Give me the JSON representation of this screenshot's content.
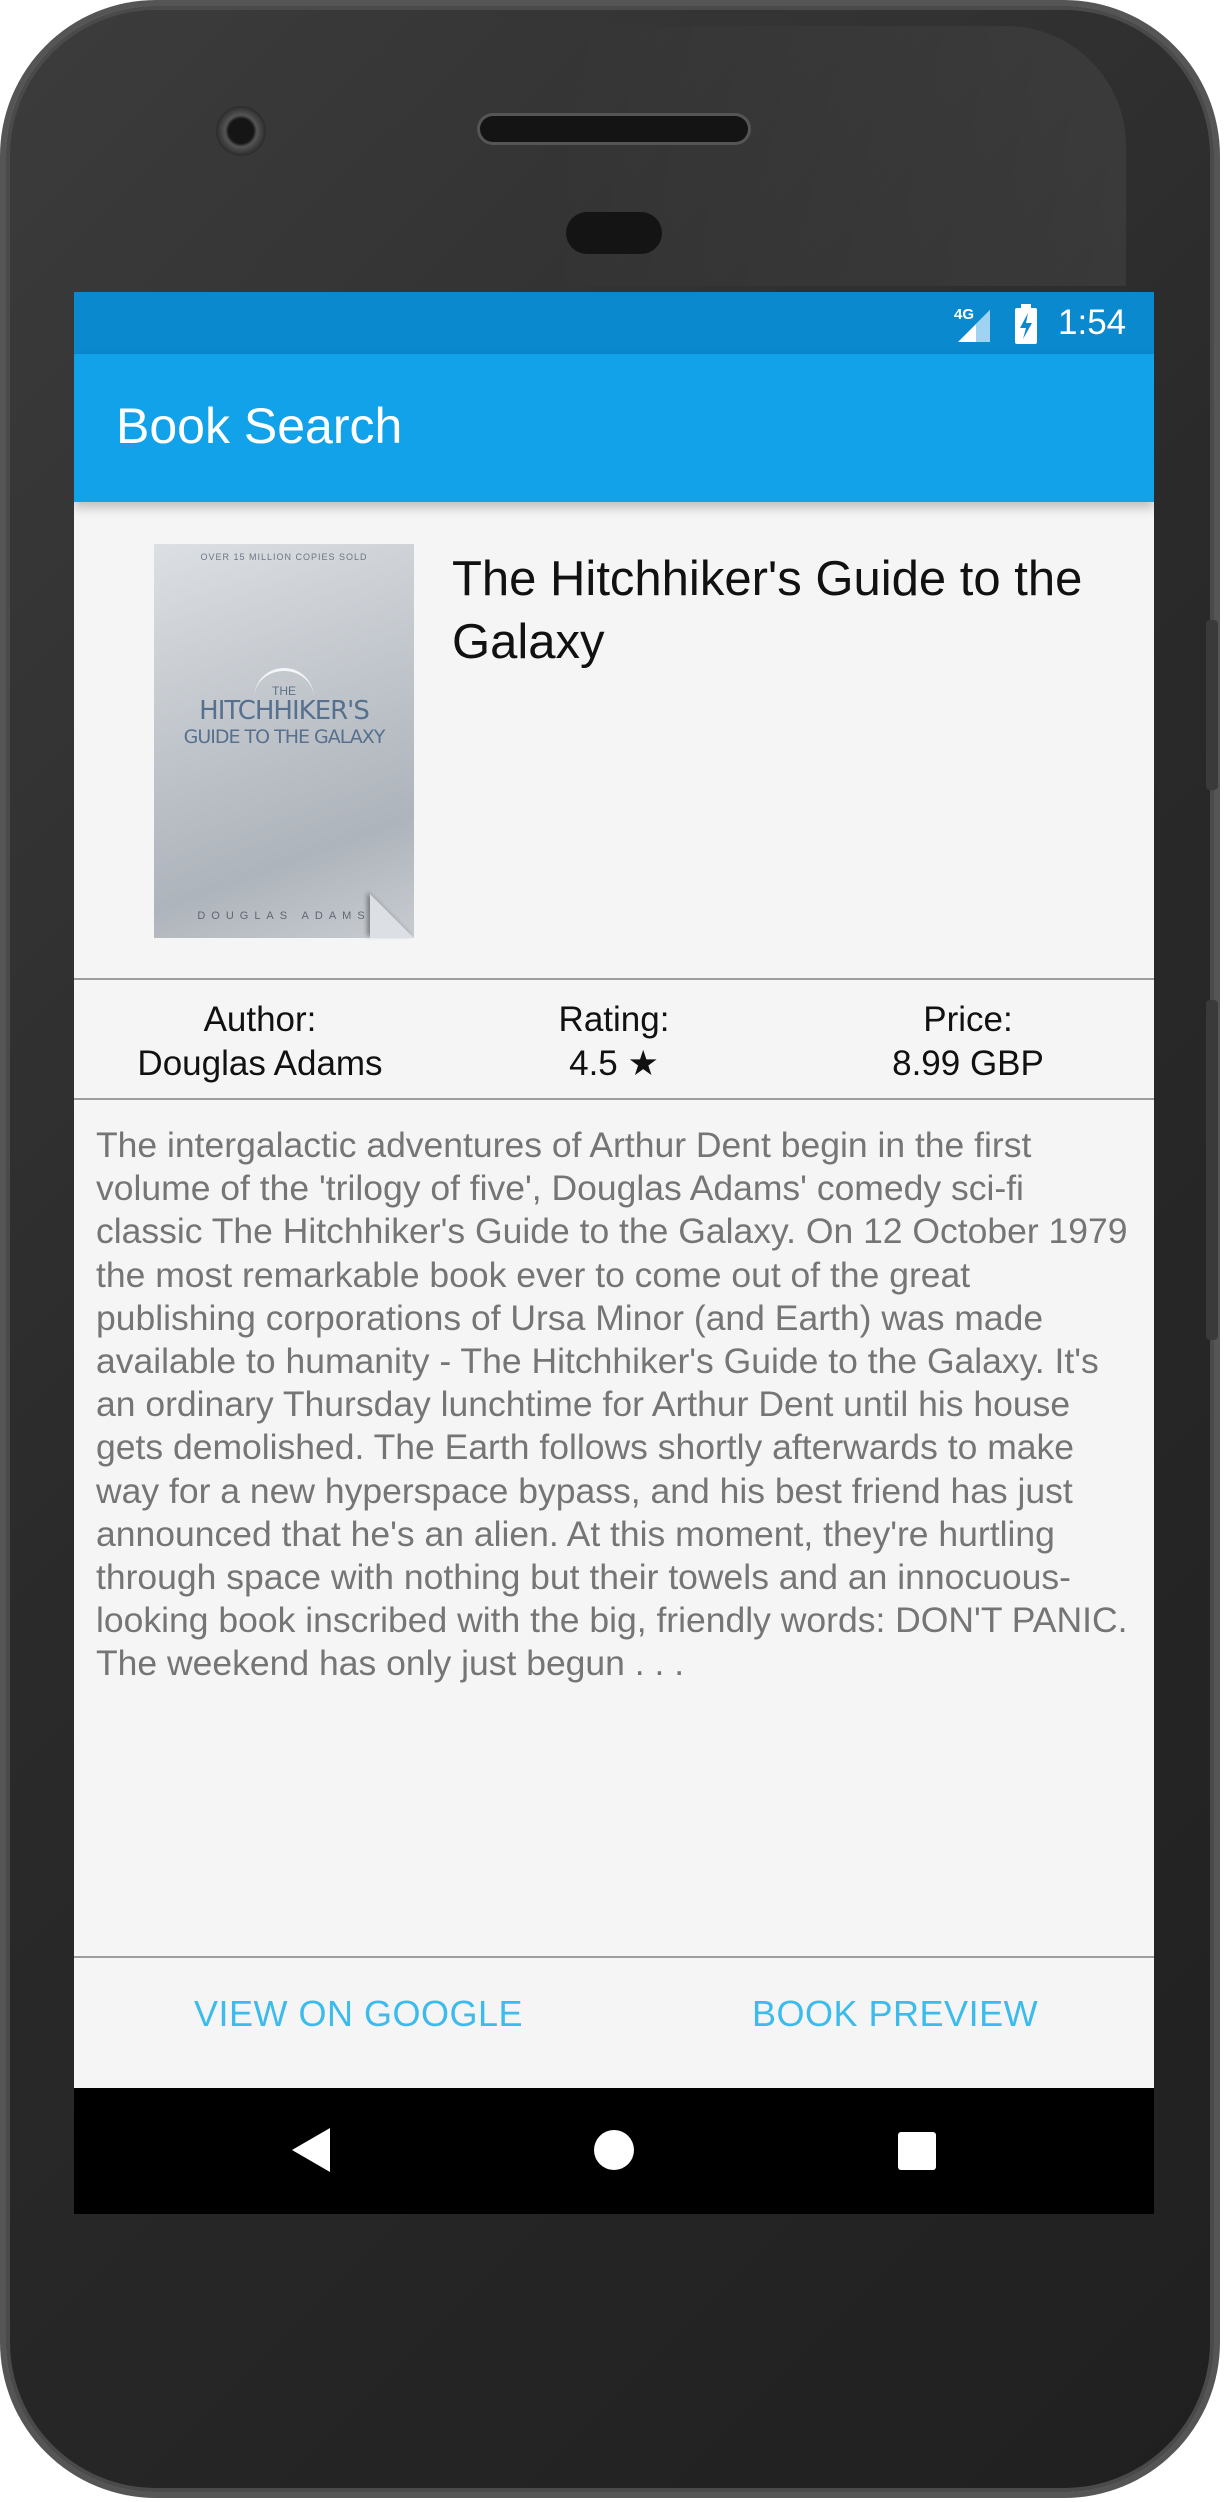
{
  "status_bar": {
    "network": "4G",
    "time": "1:54"
  },
  "app_bar": {
    "title": "Book Search"
  },
  "book": {
    "title": "The Hitchhiker's Guide to the Galaxy",
    "cover": {
      "top_text": "OVER 15 MILLION COPIES SOLD",
      "small_the": "THE",
      "line1": "HITCHHIKER'S",
      "line2": "GUIDE TO THE GALAXY",
      "author": "DOUGLAS ADAMS"
    },
    "author_label": "Author:",
    "author_value": "Douglas Adams",
    "rating_label": "Rating:",
    "rating_value": "4.5 ★",
    "price_label": "Price:",
    "price_value": "8.99 GBP",
    "description": "The intergalactic adventures of Arthur Dent begin in the first volume of the 'trilogy of five', Douglas Adams' comedy sci-fi classic The Hitchhiker's Guide to the Galaxy. On 12 October 1979 the most remarkable book ever to come out of the great publishing corporations of Ursa Minor (and Earth) was made available to humanity - The Hitchhiker's Guide to the Galaxy. It's an ordinary Thursday lunchtime for Arthur Dent until his house gets demolished. The Earth follows shortly afterwards to make way for a new hyperspace bypass, and his best friend has just announced that he's an alien. At this moment, they're hurtling through space with nothing but their towels and an innocuous-looking book inscribed with the big, friendly words: DON'T PANIC. The weekend has only just begun . . ."
  },
  "actions": {
    "view_on_google": "VIEW ON GOOGLE",
    "book_preview": "BOOK PREVIEW"
  },
  "colors": {
    "status_bar": "#0a89cf",
    "app_bar": "#12a2e9",
    "accent_text": "#3cbbec",
    "description_text": "#757575"
  },
  "icons": {
    "signal": "signal-4g-icon",
    "battery": "battery-charging-icon",
    "back": "nav-back-icon",
    "home": "nav-home-icon",
    "recents": "nav-recents-icon"
  }
}
